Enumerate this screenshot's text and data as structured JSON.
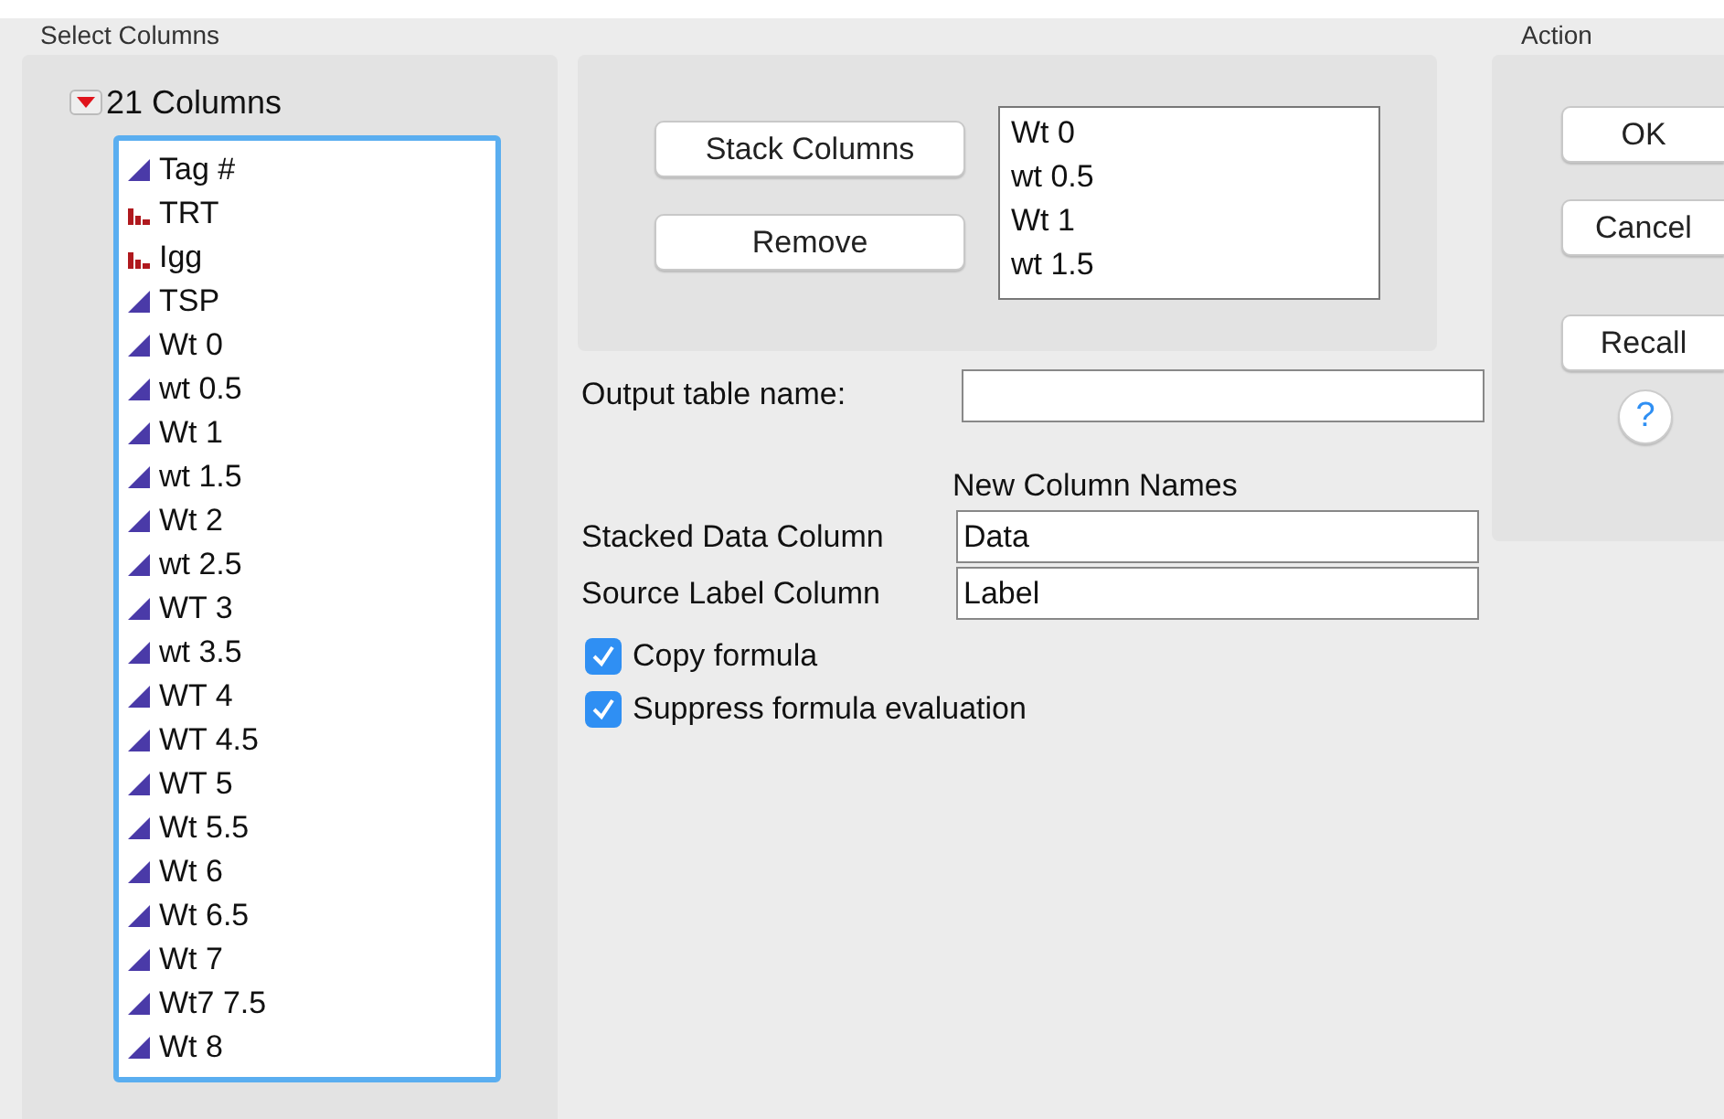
{
  "select_columns": {
    "title": "Select Columns",
    "expanded": true,
    "count_label": "21 Columns",
    "columns": [
      {
        "name": "Tag #",
        "kind": "continuous"
      },
      {
        "name": "TRT",
        "kind": "nominal"
      },
      {
        "name": "Igg",
        "kind": "nominal"
      },
      {
        "name": "TSP",
        "kind": "continuous"
      },
      {
        "name": "Wt 0",
        "kind": "continuous"
      },
      {
        "name": "wt 0.5",
        "kind": "continuous"
      },
      {
        "name": "Wt 1",
        "kind": "continuous"
      },
      {
        "name": "wt 1.5",
        "kind": "continuous"
      },
      {
        "name": "Wt 2",
        "kind": "continuous"
      },
      {
        "name": "wt 2.5",
        "kind": "continuous"
      },
      {
        "name": "WT 3",
        "kind": "continuous"
      },
      {
        "name": "wt 3.5",
        "kind": "continuous"
      },
      {
        "name": "WT 4",
        "kind": "continuous"
      },
      {
        "name": "WT 4.5",
        "kind": "continuous"
      },
      {
        "name": "WT 5",
        "kind": "continuous"
      },
      {
        "name": "Wt 5.5",
        "kind": "continuous"
      },
      {
        "name": "Wt 6",
        "kind": "continuous"
      },
      {
        "name": "Wt 6.5",
        "kind": "continuous"
      },
      {
        "name": "Wt 7",
        "kind": "continuous"
      },
      {
        "name": "Wt7 7.5",
        "kind": "continuous"
      },
      {
        "name": "Wt 8",
        "kind": "continuous"
      }
    ]
  },
  "role": {
    "buttons": [
      "Stack Columns",
      "Remove"
    ],
    "stacked": [
      "Wt 0",
      "wt 0.5",
      "Wt 1",
      "wt 1.5"
    ]
  },
  "output_table_name": {
    "label": "Output table name:"
  },
  "new_column_names": {
    "title": "New Column Names",
    "fields": [
      {
        "label": "Stacked Data Column",
        "value": "Data"
      },
      {
        "label": "Source Label Column",
        "value": "Label"
      }
    ]
  },
  "options": [
    {
      "label": "Copy formula",
      "checked": true
    },
    {
      "label": "Suppress formula evaluation",
      "checked": true
    }
  ],
  "action": {
    "title": "Action",
    "buttons": [
      "OK",
      "Cancel"
    ],
    "recall": "Recall",
    "help": "?"
  }
}
